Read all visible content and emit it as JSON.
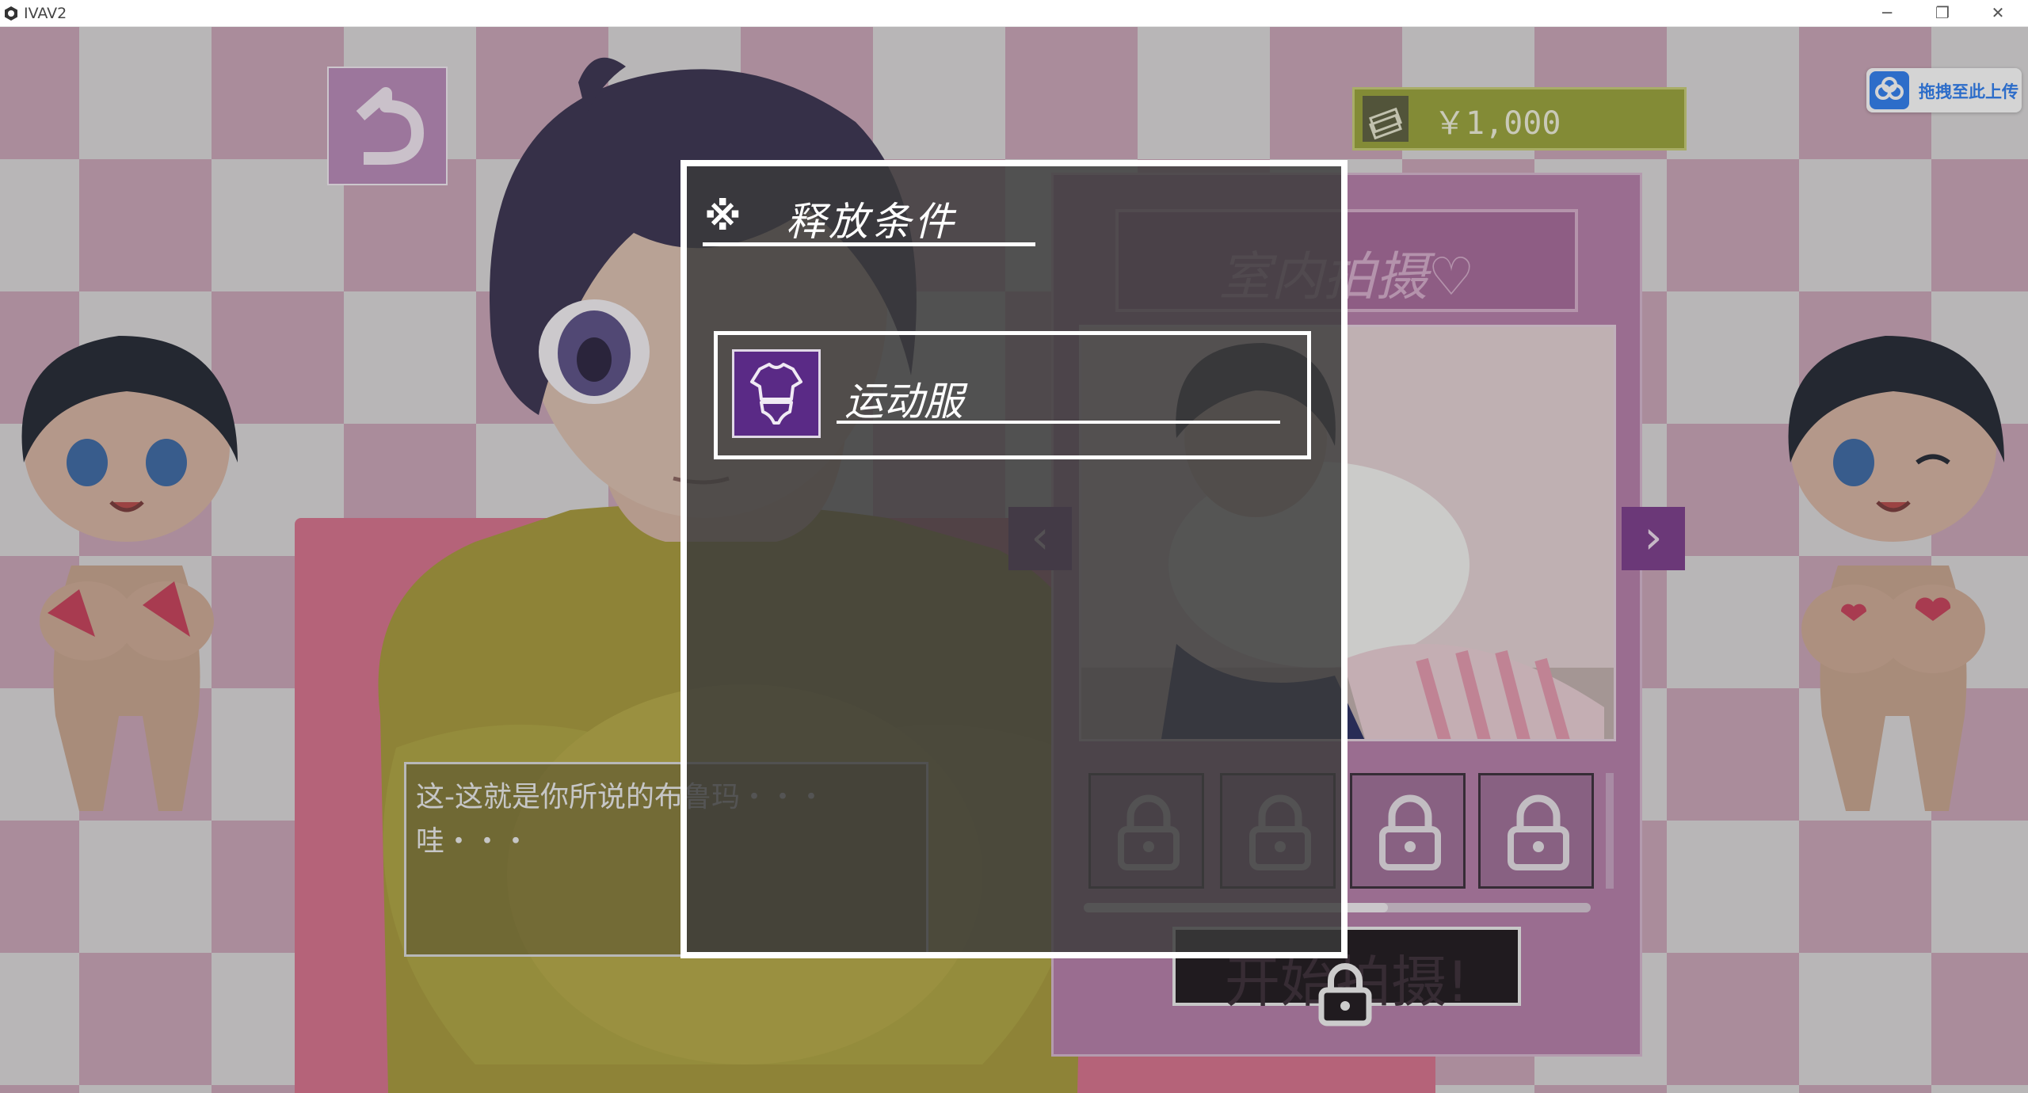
{
  "window": {
    "title": "IVAV2",
    "minimize_icon": "minimize-icon",
    "restore_icon": "restore-icon",
    "close_icon": "close-icon",
    "minimize_glyph": "─",
    "restore_glyph": "❐",
    "close_glyph": "✕"
  },
  "hud": {
    "money": "￥1,000",
    "money_icon": "money-stack-icon",
    "back_icon": "return-arrow-icon"
  },
  "upload_widget": {
    "label": "拖拽至此上传",
    "icon": "cloud-icon"
  },
  "shop": {
    "title": "室内拍摄♡",
    "prev_glyph": "‹",
    "next_glyph": "›",
    "slots": [
      {
        "locked": true
      },
      {
        "locked": true
      },
      {
        "locked": true
      },
      {
        "locked": true
      }
    ],
    "scroll_position": 0.6,
    "start_button": "开始拍摄!",
    "start_locked": true
  },
  "dialog": {
    "line1": "这-这就是你所说的布鲁玛・・・",
    "line2": "哇・・・"
  },
  "modal": {
    "title_mark": "※",
    "title": "释放条件",
    "conditions": [
      {
        "icon": "gym-uniform-icon",
        "label": "运动服"
      }
    ]
  },
  "colors": {
    "checker_pink": "#d9a2bd",
    "money_bar": "#9aa43a",
    "shop_panel": "#b77fab",
    "nav_button": "#7c3d8c",
    "condition_icon_bg": "#5a2a86",
    "upload_blue": "#2f7ff2"
  }
}
